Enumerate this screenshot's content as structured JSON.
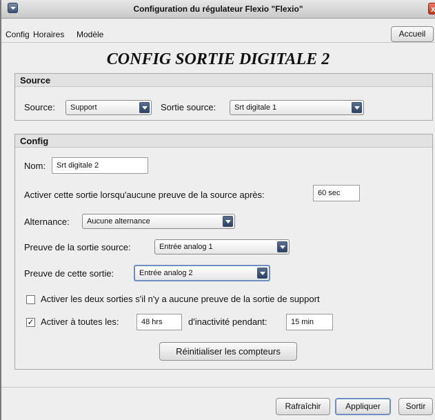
{
  "window": {
    "title": "Configuration du régulateur Flexio \"Flexio\"",
    "close_label": "x"
  },
  "menubar": {
    "items": [
      "Config",
      "Horaires",
      "Modèle"
    ],
    "home_button": "Accueil"
  },
  "page_title": "CONFIG SORTIE DIGITALE 2",
  "source": {
    "header": "Source",
    "source_label": "Source:",
    "source_value": "Support",
    "output_source_label": "Sortie source:",
    "output_source_value": "Srt digitale 1"
  },
  "config": {
    "header": "Config",
    "name_label": "Nom:",
    "name_value": "Srt digitale 2",
    "activate_label": "Activer cette sortie lorsqu'aucune preuve de la source après:",
    "activate_value": "60 sec",
    "alternation_label": "Alternance:",
    "alternation_value": "Aucune alternance",
    "proof_source_label": "Preuve de la sortie source:",
    "proof_source_value": "Entrée analog 1",
    "proof_output_label": "Preuve de cette sortie:",
    "proof_output_value": "Entrée analog 2",
    "both_outputs_label": "Activer les deux sorties s'il n'y a aucune preuve de la sortie de support",
    "both_outputs_checked": false,
    "every_label": "Activer à toutes les:",
    "every_checked": true,
    "every_value": "48 hrs",
    "inactivity_label": "d'inactivité pendant:",
    "inactivity_value": "15 min",
    "reset_button": "Réinitialiser les compteurs"
  },
  "footer": {
    "refresh": "Rafraîchir",
    "apply": "Appliquer",
    "exit": "Sortir"
  },
  "icons": {
    "window_menu": "window-menu-icon",
    "close": "close-icon",
    "dropdown": "chevron-down-icon",
    "check": "checkmark-icon"
  }
}
